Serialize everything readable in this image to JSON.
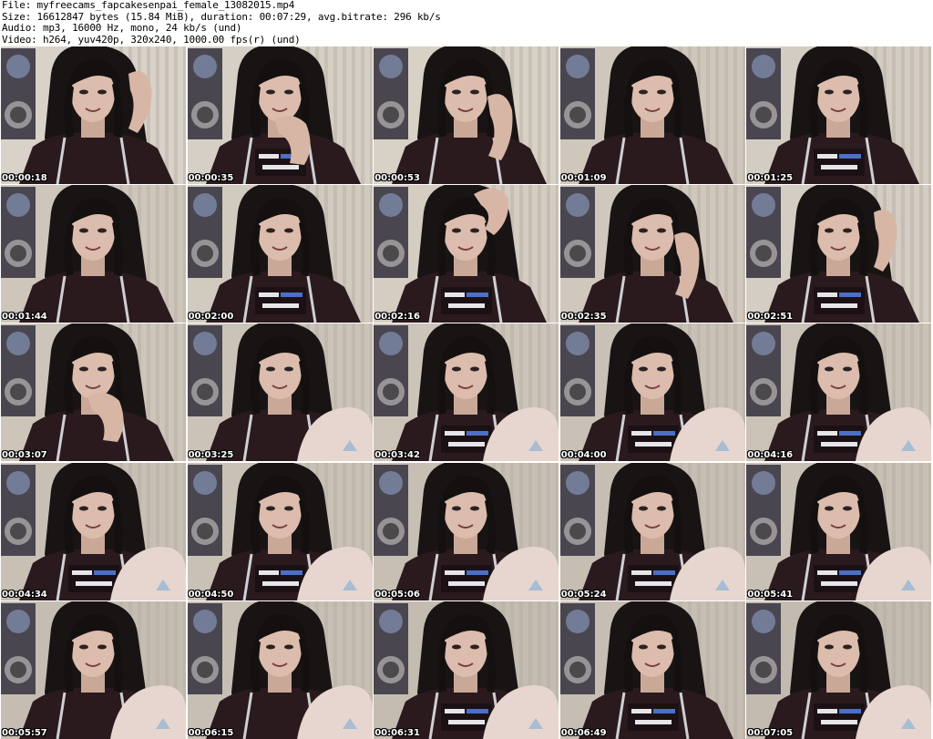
{
  "header": {
    "file": "File: myfreecams_fapcakesenpai_female_13082015.mp4",
    "size": "Size: 16612847 bytes (15.84 MiB), duration: 00:07:29, avg.bitrate: 296 kb/s",
    "audio": "Audio: mp3, 16000 Hz, mono, 24 kb/s (und)",
    "video": "Video: h264, yuv420p, 320x240, 1000.00 fps(r) (und)"
  },
  "thumbnails": [
    {
      "time": "00:00:18",
      "hand": "right-head",
      "shirt": false,
      "knee": false,
      "wall": "#d9d2c8"
    },
    {
      "time": "00:00:35",
      "hand": "chin",
      "shirt": true,
      "knee": false,
      "wall": "#d6cfc5"
    },
    {
      "time": "00:00:53",
      "hand": "cheek",
      "shirt": false,
      "knee": false,
      "wall": "#d8d1c6"
    },
    {
      "time": "00:01:09",
      "hand": "none",
      "shirt": false,
      "knee": false,
      "wall": "#cfc7bc"
    },
    {
      "time": "00:01:25",
      "hand": "none",
      "shirt": true,
      "knee": false,
      "wall": "#d3ccc2"
    },
    {
      "time": "00:01:44",
      "hand": "none",
      "shirt": false,
      "knee": false,
      "wall": "#cec6bb"
    },
    {
      "time": "00:02:00",
      "hand": "none",
      "shirt": true,
      "knee": false,
      "wall": "#d1cabf"
    },
    {
      "time": "00:02:16",
      "hand": "raised",
      "shirt": true,
      "knee": false,
      "wall": "#d5cdc2"
    },
    {
      "time": "00:02:35",
      "hand": "cheek",
      "shirt": false,
      "knee": false,
      "wall": "#d0c8bd"
    },
    {
      "time": "00:02:51",
      "hand": "right-head",
      "shirt": true,
      "knee": false,
      "wall": "#d4cdc3"
    },
    {
      "time": "00:03:07",
      "hand": "chin",
      "shirt": false,
      "knee": false,
      "wall": "#cdc5ba"
    },
    {
      "time": "00:03:25",
      "hand": "none",
      "shirt": false,
      "knee": true,
      "wall": "#cbc3b8"
    },
    {
      "time": "00:03:42",
      "hand": "none",
      "shirt": true,
      "knee": true,
      "wall": "#ccc4b9"
    },
    {
      "time": "00:04:00",
      "hand": "none",
      "shirt": true,
      "knee": true,
      "wall": "#c9c1b6"
    },
    {
      "time": "00:04:16",
      "hand": "none",
      "shirt": true,
      "knee": true,
      "wall": "#cac2b7"
    },
    {
      "time": "00:04:34",
      "hand": "none",
      "shirt": true,
      "knee": true,
      "wall": "#c8c0b5"
    },
    {
      "time": "00:04:50",
      "hand": "none",
      "shirt": true,
      "knee": true,
      "wall": "#c9c1b6"
    },
    {
      "time": "00:05:06",
      "hand": "none",
      "shirt": true,
      "knee": true,
      "wall": "#c7bfb4"
    },
    {
      "time": "00:05:24",
      "hand": "none",
      "shirt": true,
      "knee": true,
      "wall": "#c6beb3"
    },
    {
      "time": "00:05:41",
      "hand": "none",
      "shirt": true,
      "knee": true,
      "wall": "#c8c0b5"
    },
    {
      "time": "00:05:57",
      "hand": "none",
      "shirt": false,
      "knee": true,
      "wall": "#c5bdb2"
    },
    {
      "time": "00:06:15",
      "hand": "none",
      "shirt": false,
      "knee": true,
      "wall": "#c7bfb4"
    },
    {
      "time": "00:06:31",
      "hand": "none",
      "shirt": true,
      "knee": true,
      "wall": "#c4bcb1"
    },
    {
      "time": "00:06:49",
      "hand": "none",
      "shirt": true,
      "knee": false,
      "wall": "#c6beb3"
    },
    {
      "time": "00:07:05",
      "hand": "none",
      "shirt": true,
      "knee": true,
      "wall": "#c3bbb0"
    }
  ]
}
